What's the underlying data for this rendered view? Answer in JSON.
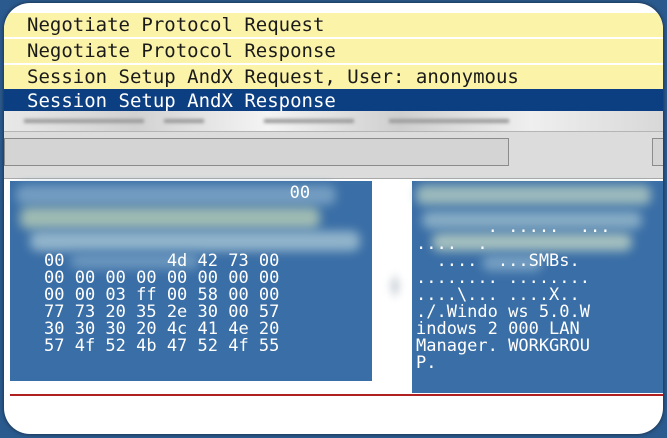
{
  "packet_list": {
    "rows": [
      {
        "text": "Negotiate Protocol Request",
        "selected": false
      },
      {
        "text": "Negotiate Protocol Response",
        "selected": false
      },
      {
        "text": "Session Setup AndX Request, User: anonymous",
        "selected": false
      },
      {
        "text": "Session Setup AndX Response",
        "selected": true
      }
    ]
  },
  "hex_dump": {
    "lines": [
      "                        00",
      "",
      "",
      "00          4d 42 73 00",
      "00 00 00 00 00 00 00 00",
      "00 00 03 ff 00 58 00 00",
      "77 73 20 35 2e 30 00 57",
      "30 30 30 20 4c 41 4e 20",
      "57 4f 52 4b 47 52 4f 55"
    ]
  },
  "ascii_dump": {
    "lines": [
      "",
      "       . .....  ...",
      "....  .",
      "  ....  ...SMBs.",
      "........ ........",
      "....\\... ....X..",
      "./.Windo ws 5.0.W",
      "indows 2 000 LAN",
      "Manager. WORKGROU",
      "P."
    ]
  },
  "colors": {
    "selected_row": "#0c3f82",
    "highlight_row": "#fbf3a8",
    "dump_background": "#3a6ea6",
    "separator_line": "#b02020"
  }
}
